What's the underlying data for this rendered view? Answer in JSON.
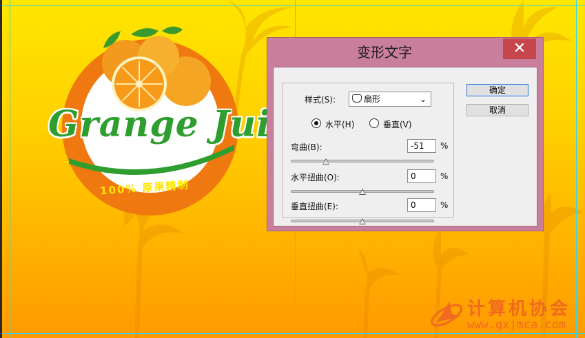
{
  "dialog": {
    "title": "变形文字",
    "close_label": "✕",
    "style_label": "样式(S):",
    "style_value": "扇形",
    "orientation": {
      "horizontal_label": "水平(H)",
      "vertical_label": "垂直(V)",
      "selected": "horizontal"
    },
    "bend": {
      "label": "弯曲(B):",
      "value": "-51",
      "unit": "%",
      "level": -51
    },
    "h_distort": {
      "label": "水平扭曲(O):",
      "value": "0",
      "unit": "%",
      "level": 0
    },
    "v_distort": {
      "label": "垂直扭曲(E):",
      "value": "0",
      "unit": "%",
      "level": 0
    },
    "ok_label": "确定",
    "cancel_label": "取消"
  },
  "artwork": {
    "logo_title": "Grange Juice",
    "logo_subtitle": "100% 原果精制",
    "watermark_title": "计算机协会",
    "watermark_url": "www.gxjmca.com"
  },
  "colors": {
    "dialog_frame": "#c97f9b",
    "close_button": "#c7464d",
    "logo_green": "#2e9e2e",
    "logo_orange": "#f07810",
    "guide": "#29d6ff"
  }
}
